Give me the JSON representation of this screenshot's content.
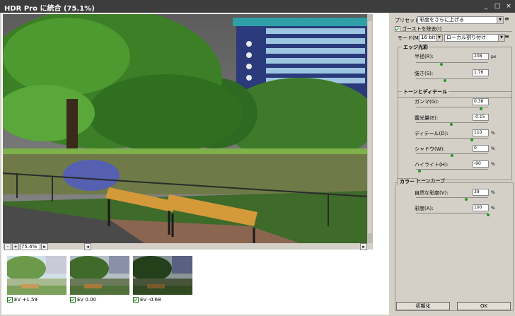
{
  "window": {
    "title": "HDR Pro に統合 (75.1%)",
    "min": "_",
    "max": "□",
    "close": "×"
  },
  "viewer": {
    "zoom": "75.4%",
    "zoom_out": "-",
    "zoom_in": "+",
    "nav_prev": "◂",
    "nav_next": "▸"
  },
  "thumbnails": [
    {
      "label": "EV +1.59",
      "checked": true
    },
    {
      "label": "EV 0.00",
      "checked": true
    },
    {
      "label": "EV -0.68",
      "checked": true
    }
  ],
  "panel": {
    "preset_label": "プリセット(E):",
    "preset_value": "彩度をさらに上げる",
    "remove_ghosts": "ゴーストを除去(I)",
    "mode_label": "モード(M):",
    "mode_value": "16 bit",
    "method_value": "ローカル割り付け",
    "edge_glow": {
      "title": "エッジ光彩",
      "radius_label": "半径(R):",
      "radius_value": "208",
      "radius_unit": "px",
      "radius_level": 0.35,
      "strength_label": "強さ(S):",
      "strength_value": "1.76",
      "strength_level": 0.4
    },
    "tone_detail": {
      "title": "トーンとディテール",
      "gamma_label": "ガンマ(G):",
      "gamma_value": "0.38",
      "gamma_level": 0.9,
      "exposure_label": "露光量(E):",
      "exposure_value": "-0.15",
      "exposure_level": 0.49,
      "detail_label": "ディテール(D):",
      "detail_value": "110",
      "detail_unit": "%",
      "detail_level": 0.77,
      "shadow_label": "シャドウ(W):",
      "shadow_value": "0",
      "shadow_unit": "%",
      "shadow_level": 0.5,
      "highlight_label": "ハイライト(H):",
      "highlight_value": "-90",
      "highlight_unit": "%",
      "highlight_level": 0.05
    },
    "color": {
      "tab_color": "カラー",
      "tab_curve": "トーンカーブ",
      "vibrance_label": "自然な彩度(V):",
      "vibrance_value": "39",
      "vibrance_unit": "%",
      "vibrance_level": 0.7,
      "saturation_label": "彩度(A):",
      "saturation_value": "100",
      "saturation_unit": "%",
      "saturation_level": 1.0
    },
    "cancel_button": "初期化",
    "ok_button": "OK"
  }
}
